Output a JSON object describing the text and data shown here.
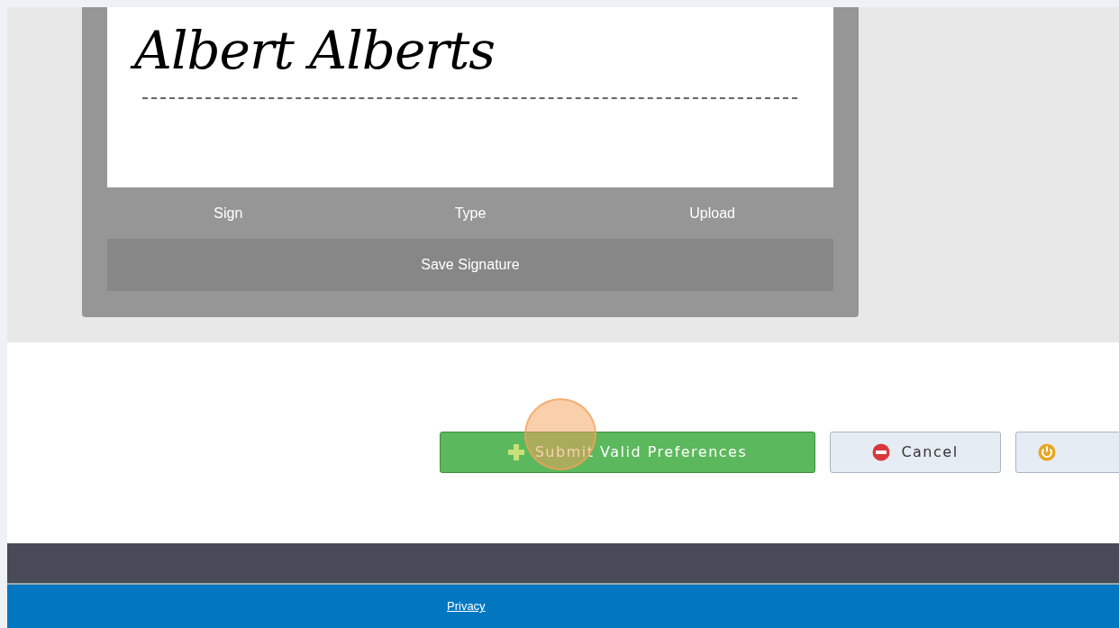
{
  "signature": {
    "typed_name": "Albert Alberts"
  },
  "signature_tabs": [
    {
      "label": "Sign"
    },
    {
      "label": "Type"
    },
    {
      "label": "Upload"
    }
  ],
  "save_button": {
    "label": "Save Signature"
  },
  "actions": [
    {
      "kind": "submit",
      "label": "Submit Valid Preferences"
    },
    {
      "kind": "cancel",
      "label": "Cancel"
    },
    {
      "kind": "power"
    }
  ],
  "footer": {
    "link": "Privacy"
  }
}
